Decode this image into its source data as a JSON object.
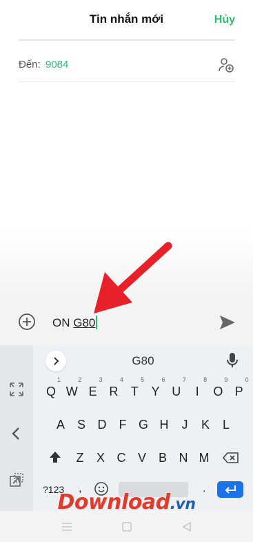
{
  "header": {
    "title": "Tin nhắn mới",
    "cancel_label": "Hủy"
  },
  "recipient": {
    "label": "Đến:",
    "value": "9084",
    "add_contact_icon": "add-contact-icon"
  },
  "compose": {
    "text_prefix": "ON ",
    "text_word": "G80",
    "placeholder": ""
  },
  "keyboard": {
    "suggestion": "G80",
    "row1": [
      {
        "k": "Q",
        "n": "1"
      },
      {
        "k": "W",
        "n": "2"
      },
      {
        "k": "E",
        "n": "3"
      },
      {
        "k": "R",
        "n": "4"
      },
      {
        "k": "T",
        "n": "5"
      },
      {
        "k": "Y",
        "n": "6"
      },
      {
        "k": "U",
        "n": "7"
      },
      {
        "k": "I",
        "n": "8"
      },
      {
        "k": "O",
        "n": "9"
      },
      {
        "k": "P",
        "n": "0"
      }
    ],
    "row2": [
      "A",
      "S",
      "D",
      "F",
      "G",
      "H",
      "J",
      "K",
      "L"
    ],
    "row3": [
      "Z",
      "X",
      "C",
      "V",
      "B",
      "N",
      "M"
    ],
    "symbols_label": "?123",
    "comma_label": ",",
    "period_label": "."
  },
  "watermark": {
    "brand": "Download",
    "tld": ".vn"
  },
  "colors": {
    "accent": "#2bbf6e",
    "enter": "#1a73e8",
    "arrow": "#e8202a",
    "watermark": "#e23b2b"
  }
}
